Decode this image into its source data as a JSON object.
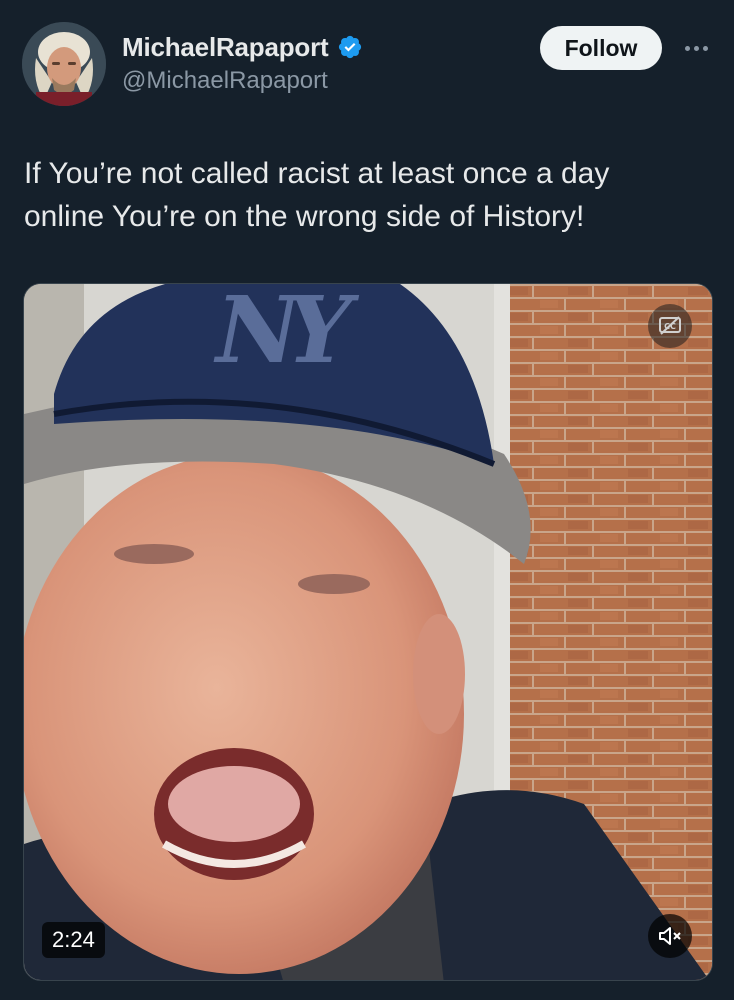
{
  "author": {
    "display_name": "MichaelRapaport",
    "handle": "@MichaelRapaport",
    "verified": true,
    "verified_color": "#1d9bf0"
  },
  "actions": {
    "follow_label": "Follow"
  },
  "tweet": {
    "text_lines": [
      "If You’re not called racist at least once a day",
      "online You’re on the wrong side of History!"
    ]
  },
  "media": {
    "type": "video",
    "duration": "2:24",
    "captions_icon": "cc-off-icon",
    "mute_icon": "volume-muted-icon",
    "cap_logo": "NY"
  },
  "colors": {
    "background": "#15202b",
    "text_primary": "#e7e9ea",
    "text_secondary": "#8b98a5",
    "follow_bg": "#eff3f4"
  }
}
